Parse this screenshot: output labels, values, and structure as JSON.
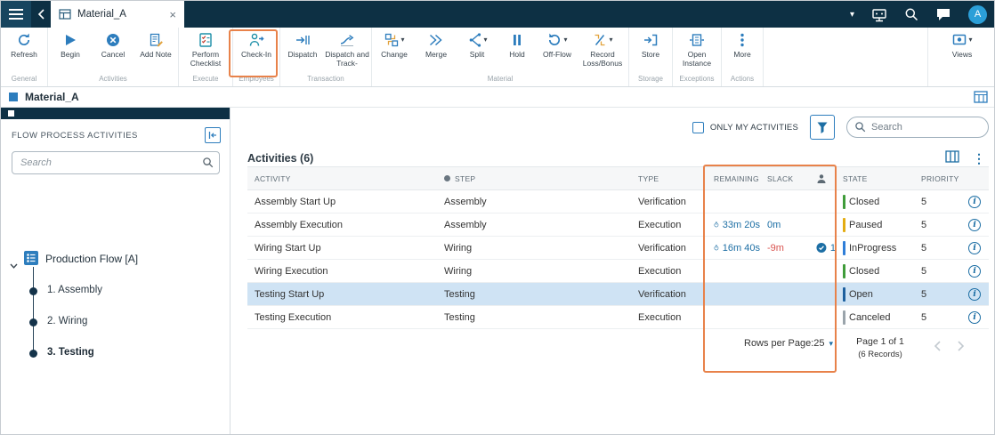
{
  "topbar": {
    "tab_title": "Material_A",
    "avatar_initial": "A"
  },
  "ribbon": {
    "groups": {
      "general": {
        "caption": "General",
        "refresh": "Refresh"
      },
      "activities": {
        "caption": "Activities",
        "begin": "Begin",
        "cancel": "Cancel",
        "add_note": "Add Note"
      },
      "execute": {
        "caption": "Execute",
        "perform_checklist": "Perform Checklist"
      },
      "employees": {
        "caption": "Employees",
        "check_in": "Check-In"
      },
      "transaction": {
        "caption": "Transaction",
        "dispatch": "Dispatch",
        "dispatch_track": "Dispatch and Track-"
      },
      "material": {
        "caption": "Material",
        "change": "Change",
        "merge": "Merge",
        "split": "Split",
        "hold": "Hold",
        "off_flow": "Off-Flow",
        "record_loss": "Record Loss/Bonus"
      },
      "storage": {
        "caption": "Storage",
        "store": "Store"
      },
      "exceptions": {
        "caption": "Exceptions",
        "open_instance": "Open Instance"
      },
      "actions": {
        "caption": "Actions",
        "more": "More"
      }
    },
    "views_label": "Views"
  },
  "titlebar": {
    "title": "Material_A"
  },
  "sidebar": {
    "header": "FLOW PROCESS ACTIVITIES",
    "search_placeholder": "Search",
    "tree_root": "Production Flow [A]",
    "tree_items": [
      {
        "label": "1. Assembly",
        "selected": false
      },
      {
        "label": "2. Wiring",
        "selected": false
      },
      {
        "label": "3. Testing",
        "selected": true
      }
    ]
  },
  "toolbar": {
    "only_my_activities_label": "ONLY MY ACTIVITIES",
    "search_placeholder": "Search"
  },
  "table": {
    "title": "Activities (6)",
    "columns": {
      "activity": "ACTIVITY",
      "step": "STEP",
      "type": "TYPE",
      "remaining": "REMAINING",
      "slack": "SLACK",
      "state": "STATE",
      "priority": "PRIORITY"
    },
    "rows": [
      {
        "activity": "Assembly Start Up",
        "step": "Assembly",
        "type": "Verification",
        "remaining": "",
        "slack": "",
        "slack_color": "",
        "assignee": "",
        "state": "Closed",
        "state_color": "#3f9c3a",
        "priority": "5",
        "selected": false
      },
      {
        "activity": "Assembly Execution",
        "step": "Assembly",
        "type": "Execution",
        "remaining": "33m 20s",
        "slack": "0m",
        "slack_color": "#1c6ea4",
        "assignee": "",
        "state": "Paused",
        "state_color": "#e3ac12",
        "priority": "5",
        "selected": false
      },
      {
        "activity": "Wiring Start Up",
        "step": "Wiring",
        "type": "Verification",
        "remaining": "16m 40s",
        "slack": "-9m",
        "slack_color": "#d9534f",
        "assignee": "1",
        "state": "InProgress",
        "state_color": "#2f7ed8",
        "priority": "5",
        "selected": false
      },
      {
        "activity": "Wiring Execution",
        "step": "Wiring",
        "type": "Execution",
        "remaining": "",
        "slack": "",
        "slack_color": "",
        "assignee": "",
        "state": "Closed",
        "state_color": "#3f9c3a",
        "priority": "5",
        "selected": false
      },
      {
        "activity": "Testing Start Up",
        "step": "Testing",
        "type": "Verification",
        "remaining": "",
        "slack": "",
        "slack_color": "",
        "assignee": "",
        "state": "Open",
        "state_color": "#1c5f9e",
        "priority": "5",
        "selected": true
      },
      {
        "activity": "Testing Execution",
        "step": "Testing",
        "type": "Execution",
        "remaining": "",
        "slack": "",
        "slack_color": "",
        "assignee": "",
        "state": "Canceled",
        "state_color": "#9aa4ab",
        "priority": "5",
        "selected": false
      }
    ],
    "pagination": {
      "rows_per_page": "Rows per Page:25",
      "page_info": "Page 1 of 1",
      "records": "(6 Records)"
    }
  },
  "icons": {
    "caret_down": "▾",
    "close": "×",
    "more_dots": "⋮",
    "info": "i"
  },
  "colors": {
    "topbar_bg": "#0d3044",
    "accent": "#1c6ea4",
    "annotation": "#e8824a",
    "selected_row_bg": "#cfe3f4",
    "state_closed": "#3f9c3a",
    "state_paused": "#e3ac12",
    "state_inprogress": "#2f7ed8",
    "state_open": "#1c5f9e",
    "state_canceled": "#9aa4ab",
    "slack_negative": "#d9534f"
  }
}
